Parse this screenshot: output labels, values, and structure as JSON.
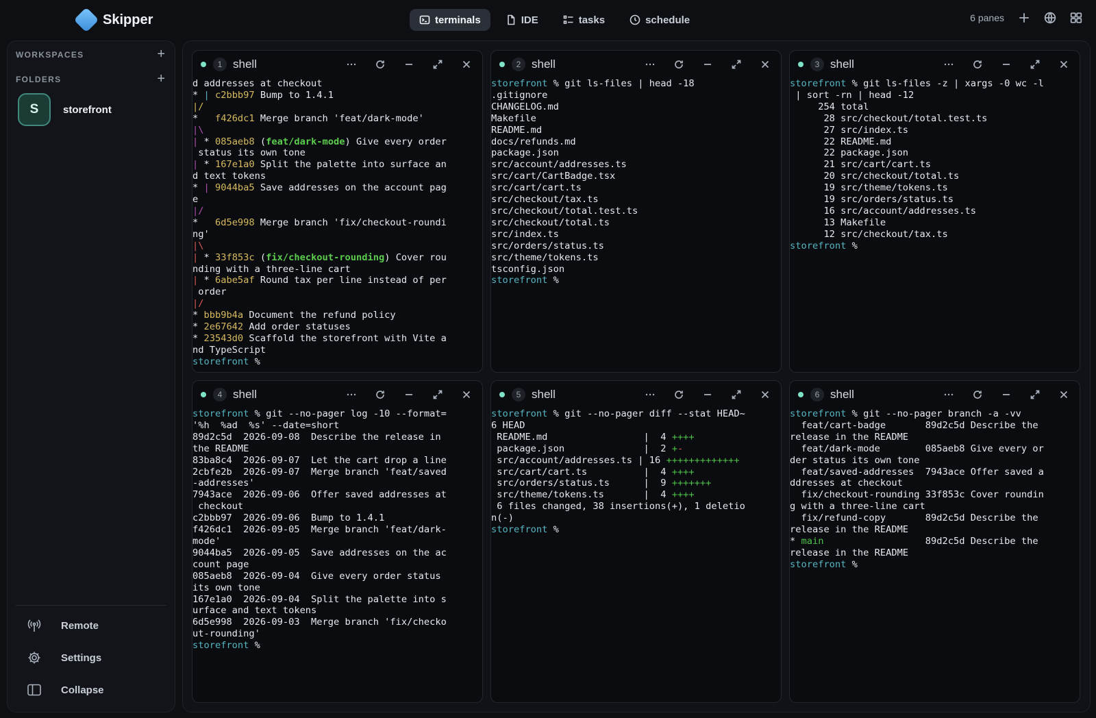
{
  "app": {
    "name": "Skipper"
  },
  "tabs": [
    {
      "label": "terminals",
      "icon": "terminal-icon",
      "active": true
    },
    {
      "label": "IDE",
      "icon": "file-icon",
      "active": false
    },
    {
      "label": "tasks",
      "icon": "list-icon",
      "active": false
    },
    {
      "label": "schedule",
      "icon": "clock-icon",
      "active": false
    }
  ],
  "topright": {
    "panes_label": "6 panes"
  },
  "sidebar": {
    "workspaces_label": "WORKSPACES",
    "folders_label": "FOLDERS",
    "folder": {
      "initial": "S",
      "name": "storefront"
    },
    "bottom": [
      {
        "label": "Remote",
        "icon": "antenna-icon"
      },
      {
        "label": "Settings",
        "icon": "gear-icon"
      },
      {
        "label": "Collapse",
        "icon": "sidebar-icon"
      }
    ]
  },
  "panes": [
    {
      "num": "1",
      "title": "shell",
      "lines": [
        [
          [
            "d addresses at checkout"
          ]
        ],
        [
          [
            "* "
          ],
          [
            "| ",
            "c"
          ],
          [
            "c2bbb97",
            "y"
          ],
          [
            " Bump to 1.4.1"
          ]
        ],
        [
          [
            "|/",
            "y"
          ]
        ],
        [
          [
            "*   "
          ],
          [
            "f426dc1",
            "y"
          ],
          [
            " Merge branch 'feat/dark-mode'"
          ]
        ],
        [
          [
            "|\\",
            "m"
          ]
        ],
        [
          [
            "| ",
            "m"
          ],
          [
            "* "
          ],
          [
            "085aeb8",
            "y"
          ],
          [
            " ("
          ],
          [
            "feat/dark-mode",
            "g"
          ],
          [
            ")"
          ],
          [
            " Give every order"
          ]
        ],
        [
          [
            " status its own tone"
          ]
        ],
        [
          [
            "| ",
            "m"
          ],
          [
            "* "
          ],
          [
            "167e1a0",
            "y"
          ],
          [
            " Split the palette into surface an"
          ]
        ],
        [
          [
            "d text tokens"
          ]
        ],
        [
          [
            "* "
          ],
          [
            "| ",
            "m"
          ],
          [
            "9044ba5",
            "y"
          ],
          [
            " Save addresses on the account pag"
          ]
        ],
        [
          [
            "e"
          ]
        ],
        [
          [
            "|/",
            "m"
          ]
        ],
        [
          [
            "*   "
          ],
          [
            "6d5e998",
            "y"
          ],
          [
            " Merge branch 'fix/checkout-roundi"
          ]
        ],
        [
          [
            "ng'"
          ]
        ],
        [
          [
            "|\\",
            "r"
          ]
        ],
        [
          [
            "| ",
            "r"
          ],
          [
            "* "
          ],
          [
            "33f853c",
            "y"
          ],
          [
            " ("
          ],
          [
            "fix/checkout-rounding",
            "g"
          ],
          [
            ")"
          ],
          [
            " Cover rou"
          ]
        ],
        [
          [
            "nding with a three-line cart"
          ]
        ],
        [
          [
            "| ",
            "r"
          ],
          [
            "* "
          ],
          [
            "6abe5af",
            "y"
          ],
          [
            " Round tax per line instead of per"
          ]
        ],
        [
          [
            " order"
          ]
        ],
        [
          [
            "|/",
            "r"
          ]
        ],
        [
          [
            "* "
          ],
          [
            "bbb9b4a",
            "y"
          ],
          [
            " Document the refund policy"
          ]
        ],
        [
          [
            "* "
          ],
          [
            "2e67642",
            "y"
          ],
          [
            " Add order statuses"
          ]
        ],
        [
          [
            "* "
          ],
          [
            "23543d0",
            "y"
          ],
          [
            " Scaffold the storefront with Vite a"
          ]
        ],
        [
          [
            "nd TypeScript"
          ]
        ],
        [
          [
            "storefront",
            "p"
          ],
          [
            " %"
          ]
        ]
      ]
    },
    {
      "num": "2",
      "title": "shell",
      "lines": [
        [
          [
            "storefront",
            "p"
          ],
          [
            " % git ls-files | head -18"
          ]
        ],
        [
          [
            ".gitignore"
          ]
        ],
        [
          [
            "CHANGELOG.md"
          ]
        ],
        [
          [
            "Makefile"
          ]
        ],
        [
          [
            "README.md"
          ]
        ],
        [
          [
            "docs/refunds.md"
          ]
        ],
        [
          [
            "package.json"
          ]
        ],
        [
          [
            "src/account/addresses.ts"
          ]
        ],
        [
          [
            "src/cart/CartBadge.tsx"
          ]
        ],
        [
          [
            "src/cart/cart.ts"
          ]
        ],
        [
          [
            "src/checkout/tax.ts"
          ]
        ],
        [
          [
            "src/checkout/total.test.ts"
          ]
        ],
        [
          [
            "src/checkout/total.ts"
          ]
        ],
        [
          [
            "src/index.ts"
          ]
        ],
        [
          [
            "src/orders/status.ts"
          ]
        ],
        [
          [
            "src/theme/tokens.ts"
          ]
        ],
        [
          [
            "tsconfig.json"
          ]
        ],
        [
          [
            "storefront",
            "p"
          ],
          [
            " %"
          ]
        ]
      ]
    },
    {
      "num": "3",
      "title": "shell",
      "lines": [
        [
          [
            "storefront",
            "p"
          ],
          [
            " % git ls-files -z | xargs -0 wc -l"
          ]
        ],
        [
          [
            " | sort -rn | head -12"
          ]
        ],
        [
          [
            "     254 total"
          ]
        ],
        [
          [
            "      28 src/checkout/total.test.ts"
          ]
        ],
        [
          [
            "      27 src/index.ts"
          ]
        ],
        [
          [
            "      22 README.md"
          ]
        ],
        [
          [
            "      22 package.json"
          ]
        ],
        [
          [
            "      21 src/cart/cart.ts"
          ]
        ],
        [
          [
            "      20 src/checkout/total.ts"
          ]
        ],
        [
          [
            "      19 src/theme/tokens.ts"
          ]
        ],
        [
          [
            "      19 src/orders/status.ts"
          ]
        ],
        [
          [
            "      16 src/account/addresses.ts"
          ]
        ],
        [
          [
            "      13 Makefile"
          ]
        ],
        [
          [
            "      12 src/checkout/tax.ts"
          ]
        ],
        [
          [
            "storefront",
            "p"
          ],
          [
            " %"
          ]
        ]
      ]
    },
    {
      "num": "4",
      "title": "shell",
      "lines": [
        [
          [
            "storefront",
            "p"
          ],
          [
            " % git --no-pager log -10 --format="
          ]
        ],
        [
          [
            "'%h  %ad  %s' --date=short"
          ]
        ],
        [
          [
            "89d2c5d  2026-09-08  Describe the release in"
          ]
        ],
        [
          [
            "the README"
          ]
        ],
        [
          [
            "83ba8c4  2026-09-07  Let the cart drop a line"
          ]
        ],
        [
          [
            "2cbfe2b  2026-09-07  Merge branch 'feat/saved"
          ]
        ],
        [
          [
            "-addresses'"
          ]
        ],
        [
          [
            "7943ace  2026-09-06  Offer saved addresses at"
          ]
        ],
        [
          [
            " checkout"
          ]
        ],
        [
          [
            "c2bbb97  2026-09-06  Bump to 1.4.1"
          ]
        ],
        [
          [
            "f426dc1  2026-09-05  Merge branch 'feat/dark-"
          ]
        ],
        [
          [
            "mode'"
          ]
        ],
        [
          [
            "9044ba5  2026-09-05  Save addresses on the ac"
          ]
        ],
        [
          [
            "count page"
          ]
        ],
        [
          [
            "085aeb8  2026-09-04  Give every order status"
          ]
        ],
        [
          [
            "its own tone"
          ]
        ],
        [
          [
            "167e1a0  2026-09-04  Split the palette into s"
          ]
        ],
        [
          [
            "urface and text tokens"
          ]
        ],
        [
          [
            "6d5e998  2026-09-03  Merge branch 'fix/checko"
          ]
        ],
        [
          [
            "ut-rounding'"
          ]
        ],
        [
          [
            "storefront",
            "p"
          ],
          [
            " %"
          ]
        ]
      ]
    },
    {
      "num": "5",
      "title": "shell",
      "lines": [
        [
          [
            "storefront",
            "p"
          ],
          [
            " % git --no-pager diff --stat HEAD~"
          ]
        ],
        [
          [
            "6 HEAD"
          ]
        ],
        [
          [
            " README.md                 |  4 "
          ],
          [
            "++++",
            "gr"
          ]
        ],
        [
          [
            " package.json              |  2 "
          ],
          [
            "+",
            "gr"
          ],
          [
            "-",
            "r"
          ]
        ],
        [
          [
            " src/account/addresses.ts | 16 "
          ],
          [
            "+++++++++++++",
            "gr"
          ]
        ],
        [
          [
            " src/cart/cart.ts          |  4 "
          ],
          [
            "++++",
            "gr"
          ]
        ],
        [
          [
            " src/orders/status.ts      |  9 "
          ],
          [
            "+++++++",
            "gr"
          ]
        ],
        [
          [
            " src/theme/tokens.ts       |  4 "
          ],
          [
            "++++",
            "gr"
          ]
        ],
        [
          [
            " 6 files changed, 38 insertions(+), 1 deletio"
          ]
        ],
        [
          [
            "n(-)"
          ]
        ],
        [
          [
            "storefront",
            "p"
          ],
          [
            " %"
          ]
        ]
      ]
    },
    {
      "num": "6",
      "title": "shell",
      "lines": [
        [
          [
            "storefront",
            "p"
          ],
          [
            " % git --no-pager branch -a -vv"
          ]
        ],
        [
          [
            "  feat/cart-badge       89d2c5d Describe the"
          ]
        ],
        [
          [
            "release in the README"
          ]
        ],
        [
          [
            "  feat/dark-mode        085aeb8 Give every or"
          ]
        ],
        [
          [
            "der status its own tone"
          ]
        ],
        [
          [
            "  feat/saved-addresses  7943ace Offer saved a"
          ]
        ],
        [
          [
            "ddresses at checkout"
          ]
        ],
        [
          [
            "  fix/checkout-rounding 33f853c Cover roundin"
          ]
        ],
        [
          [
            "g with a three-line cart"
          ]
        ],
        [
          [
            "  fix/refund-copy       89d2c5d Describe the"
          ]
        ],
        [
          [
            "release in the README"
          ]
        ],
        [
          [
            "* "
          ],
          [
            "main",
            "gm"
          ],
          [
            "                  89d2c5d Describe the"
          ]
        ],
        [
          [
            "release in the README"
          ]
        ],
        [
          [
            "storefront",
            "p"
          ],
          [
            " %"
          ]
        ]
      ]
    }
  ]
}
